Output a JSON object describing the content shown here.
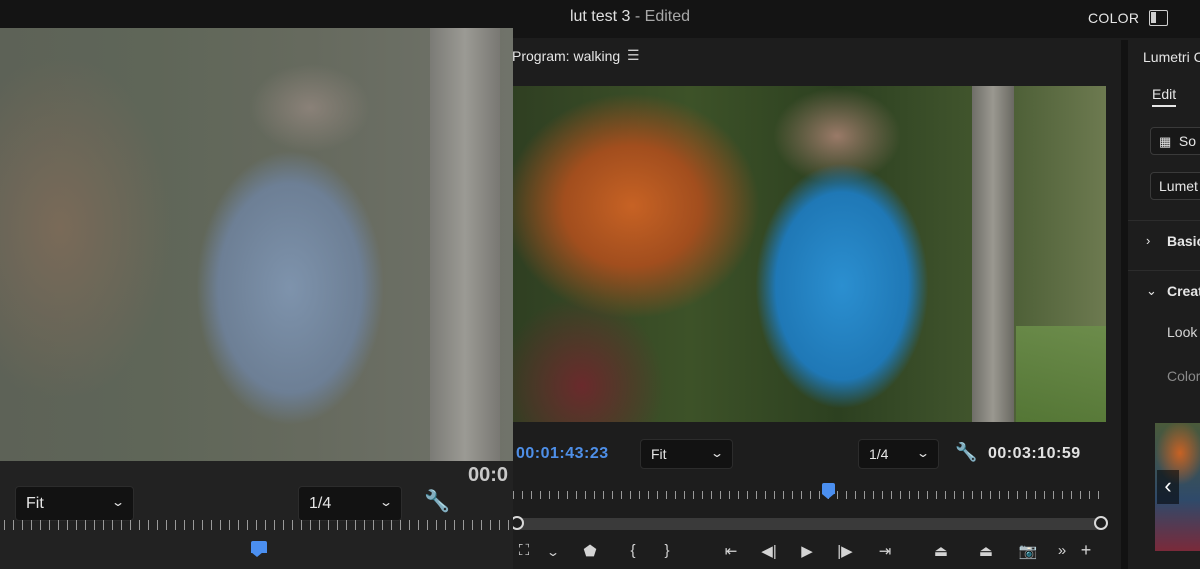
{
  "header": {
    "project_name": "lut test 3",
    "status": "- Edited",
    "workspace": "COLOR"
  },
  "program_monitor": {
    "title": "Program: walking",
    "menu_icon": "hamburger-icon",
    "current_timecode": "00:01:43:23",
    "duration": "00:03:10:59",
    "zoom": "Fit",
    "resolution": "1/4",
    "playhead_position": 0.53,
    "transport_icons": [
      "add-marker-icon",
      "chevron-down-icon",
      "marker-icon",
      "mark-in-icon",
      "mark-out-icon",
      "go-to-in-icon",
      "step-back-icon",
      "play-icon",
      "step-forward-icon",
      "go-to-out-icon",
      "lift-icon",
      "extract-icon",
      "export-frame-icon",
      "more-icon",
      "add-button-icon"
    ]
  },
  "source_monitor": {
    "zoom": "Fit",
    "resolution": "1/4",
    "timecode": "00:0",
    "playhead_position": 0.5
  },
  "lumetri": {
    "title": "Lumetri C",
    "tab_edit": "Edit",
    "source_button": "So",
    "preset_button": "Lumet",
    "section_basic": "Basic",
    "section_creative": "Creat",
    "look_label": "Look",
    "color_label": "Color"
  }
}
